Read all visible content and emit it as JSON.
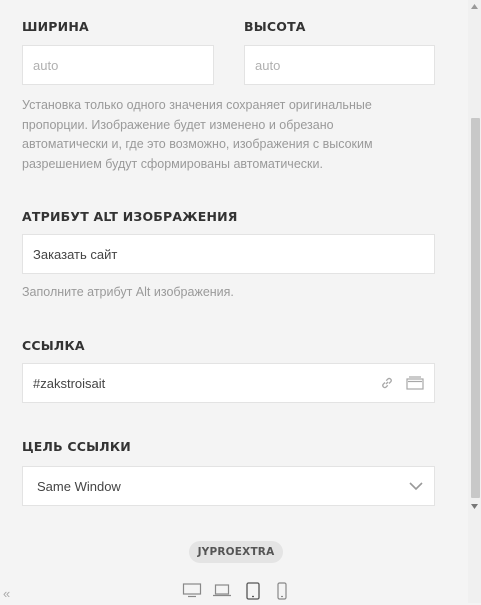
{
  "width_field": {
    "label": "ШИРИНА",
    "placeholder": "auto"
  },
  "height_field": {
    "label": "ВЫСОТА",
    "placeholder": "auto"
  },
  "size_help": [
    "Установка только одного значения сохраняет оригинальные",
    "пропорции. Изображение будет изменено и обрезано",
    "автоматически и, где это возможно, изображения с высоким",
    "разрешением будут сформированы автоматически."
  ],
  "alt_field": {
    "label": "АТРИБУТ ALT ИЗОБРАЖЕНИЯ",
    "value": "Заказать сайт",
    "help": "Заполните атрибут Alt изображения."
  },
  "link_field": {
    "label": "ССЫЛКА",
    "value": "#zakstroisait"
  },
  "link_target": {
    "label": "ЦЕЛЬ ССЫЛКИ",
    "selected": "Same Window"
  },
  "footer": {
    "badge": "JYPROEXTRA",
    "collapse": "«"
  },
  "devices": [
    "desktop-icon",
    "laptop-icon",
    "tablet-icon",
    "phone-icon"
  ]
}
